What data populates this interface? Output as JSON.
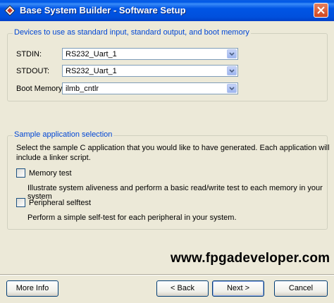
{
  "window": {
    "title": "Base System Builder - Software Setup"
  },
  "devices_group": {
    "label": "Devices to use as standard input, standard output, and boot memory",
    "rows": [
      {
        "label": "STDIN:",
        "value": "RS232_Uart_1"
      },
      {
        "label": "STDOUT:",
        "value": "RS232_Uart_1"
      },
      {
        "label": "Boot Memory:",
        "value": "ilmb_cntlr"
      }
    ]
  },
  "sample_group": {
    "label": "Sample application selection",
    "intro_line1": "Select the sample C application that you would like to have generated.  Each application will",
    "intro_line2": "include a linker script.",
    "options": [
      {
        "label": "Memory test",
        "checked": false,
        "description": "Illustrate system aliveness and perform a basic read/write test to each memory in your system"
      },
      {
        "label": "Peripheral selftest",
        "checked": false,
        "description": "Perform a simple self-test for each peripheral in your system."
      }
    ]
  },
  "watermark": "www.fpgadeveloper.com",
  "buttons": {
    "more_info": "More Info",
    "back": "< Back",
    "next": "Next >",
    "cancel": "Cancel"
  },
  "icons": [
    "app-icon",
    "close-icon",
    "chevron-down-icon"
  ]
}
